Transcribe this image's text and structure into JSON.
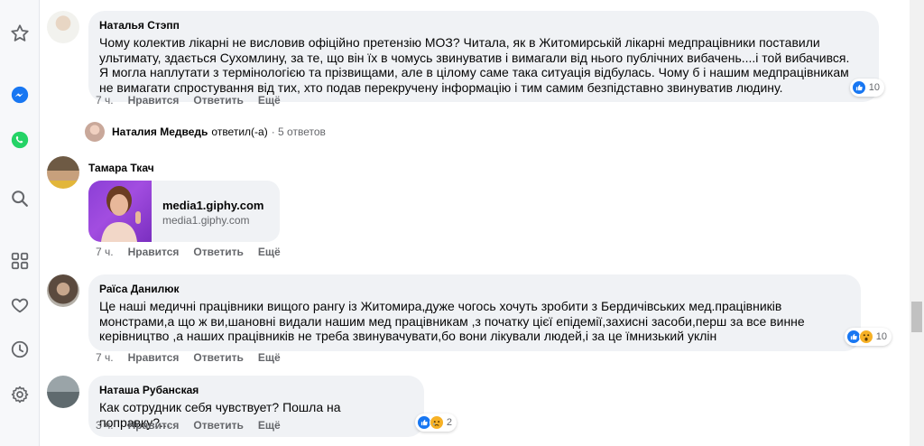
{
  "sidebar": {
    "icons": [
      "star-icon",
      "messenger-icon",
      "whatsapp-icon",
      "search-icon",
      "apps-grid-icon",
      "heart-icon",
      "clock-icon",
      "gear-icon"
    ]
  },
  "colors": {
    "accent": "#1877f2",
    "bubble": "#f0f2f5",
    "meta": "#65676b"
  },
  "comments": [
    {
      "author": "Наталья Стэпп",
      "text": "Чому колектив лікарні не висловив офіційно претензію МОЗ? Читала, як в Житомирській лікарні медпрацівники поставили ультимату, здається Сухомлину, за те, що він їх в чомусь звинуватив і вимагали від нього публічних вибачень....і той вибачився. Я могла наплутати з термінологією та прізвищами, але в цілому саме така ситуація відбулась. Чому б і нашим медпрацівникам не вимагати спростування від тих, хто подав перекручену інформацію і тим самим безпідставно звинуватив людину.",
      "time": "7 ч.",
      "like": "Нравится",
      "reply": "Ответить",
      "more": "Ещё",
      "reaction_count": "10"
    },
    {
      "author": "Тамара Ткач",
      "link_title": "media1.giphy.com",
      "link_sub": "media1.giphy.com",
      "time": "7 ч.",
      "like": "Нравится",
      "reply": "Ответить",
      "more": "Ещё"
    },
    {
      "author": "Раїса Данилюк",
      "text": "Це наші медичні працівники вищого рангу із Житомира,дуже чогось хочуть зробити з Бердичівських мед.працівників монстрами,а що ж ви,шановні видали нашим мед працівникам ,з початку цієї епідемії,захисні засоби,перш за все винне керівництво ,а наших працівників не треба звинувачувати,бо вони лікували людей,і за це їмнизький уклін",
      "time": "7 ч.",
      "like": "Нравится",
      "reply": "Ответить",
      "more": "Ещё",
      "reaction_count": "10"
    },
    {
      "author": "Наташа Рубанская",
      "text": "Как сотрудник себя чувствует? Пошла на поправку?...",
      "time": "3 ч.",
      "like": "Нравится",
      "reply": "Ответить",
      "more": "Ещё",
      "reaction_count": "2"
    }
  ],
  "reply_summary": {
    "name": "Наталия Медведь",
    "verb": "ответил(-а)",
    "count": "· 5 ответов"
  }
}
